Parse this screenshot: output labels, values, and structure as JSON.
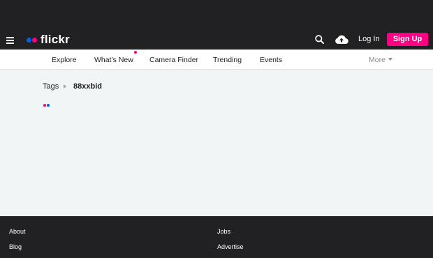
{
  "header": {
    "logo_text": "flickr",
    "login_label": "Log In",
    "signup_label": "Sign Up"
  },
  "nav": {
    "items": [
      {
        "label": "Explore"
      },
      {
        "label": "What’s New"
      },
      {
        "label": "Camera Finder"
      },
      {
        "label": "Trending"
      },
      {
        "label": "Events"
      }
    ],
    "more_label": "More"
  },
  "breadcrumb": {
    "parent": "Tags",
    "current": "88xxbid"
  },
  "footer": {
    "links": [
      {
        "label": "About"
      },
      {
        "label": "Blog"
      },
      {
        "label": "Jobs"
      },
      {
        "label": "Advertise"
      }
    ]
  },
  "colors": {
    "header_bg": "#212124",
    "brand_pink": "#ff0084",
    "brand_blue": "#0063dc",
    "page_bg": "#f2f5f6"
  }
}
